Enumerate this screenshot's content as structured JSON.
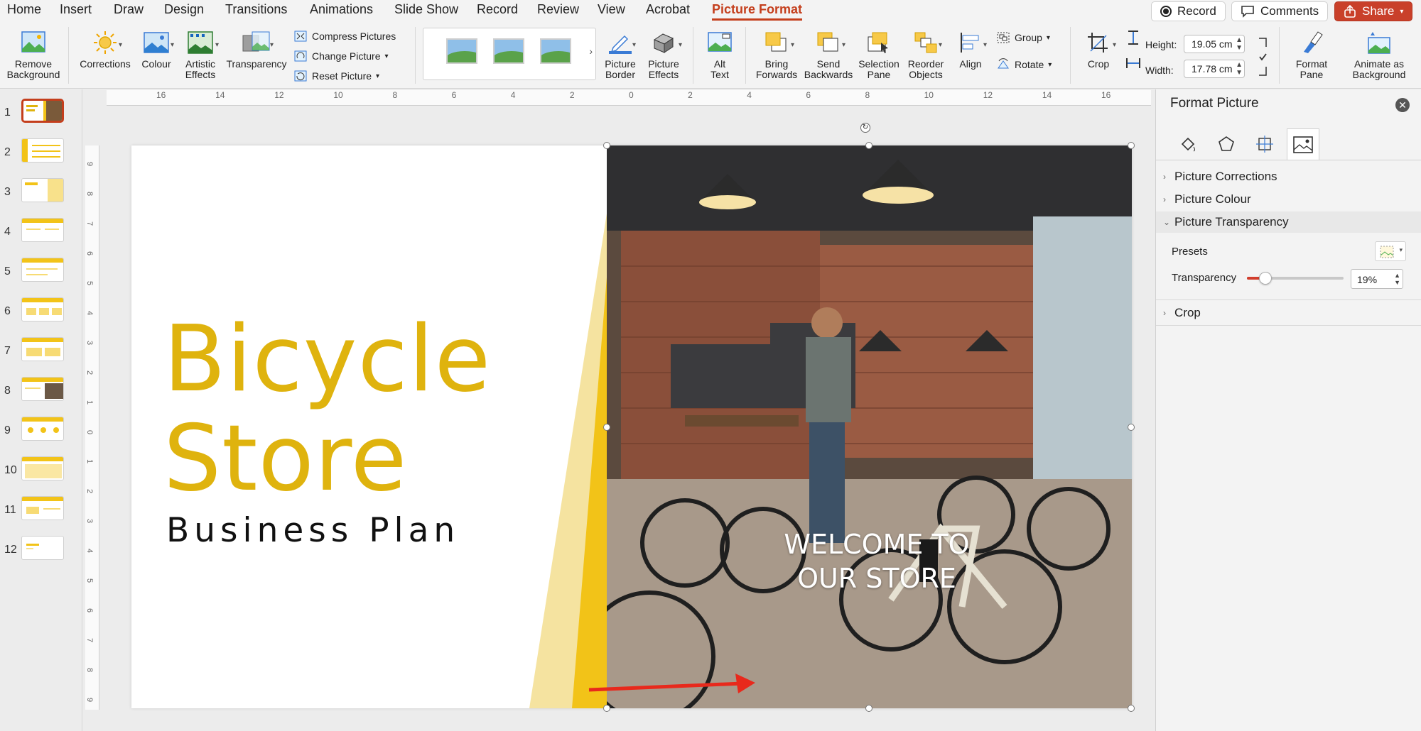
{
  "tabs": [
    {
      "label": "Home"
    },
    {
      "label": "Insert"
    },
    {
      "label": "Draw"
    },
    {
      "label": "Design"
    },
    {
      "label": "Transitions"
    },
    {
      "label": "Animations"
    },
    {
      "label": "Slide Show"
    },
    {
      "label": "Record"
    },
    {
      "label": "Review"
    },
    {
      "label": "View"
    },
    {
      "label": "Acrobat"
    },
    {
      "label": "Picture Format",
      "active": true
    }
  ],
  "top_buttons": {
    "record": "Record",
    "comments": "Comments",
    "share": "Share"
  },
  "ribbon": {
    "remove_background": "Remove\nBackground",
    "corrections": "Corrections",
    "colour": "Colour",
    "artistic_effects": "Artistic\nEffects",
    "transparency": "Transparency",
    "compress_pictures": "Compress Pictures",
    "change_picture": "Change Picture",
    "reset_picture": "Reset Picture",
    "picture_border": "Picture\nBorder",
    "picture_effects": "Picture\nEffects",
    "alt_text": "Alt\nText",
    "bring_forwards": "Bring\nForwards",
    "send_backwards": "Send\nBackwards",
    "selection_pane": "Selection\nPane",
    "reorder_objects": "Reorder\nObjects",
    "align": "Align",
    "group": "Group",
    "rotate": "Rotate",
    "crop": "Crop",
    "height_label": "Height:",
    "height_value": "19.05 cm",
    "width_label": "Width:",
    "width_value": "17.78 cm",
    "format_pane": "Format\nPane",
    "animate_as_background": "Animate as\nBackground"
  },
  "ruler": {
    "h_ticks": [
      "16",
      "14",
      "12",
      "10",
      "8",
      "6",
      "4",
      "2",
      "0",
      "2",
      "4",
      "6",
      "8",
      "10",
      "12",
      "14",
      "16"
    ],
    "v_ticks": [
      "9",
      "8",
      "7",
      "6",
      "5",
      "4",
      "3",
      "2",
      "1",
      "0",
      "1",
      "2",
      "3",
      "4",
      "5",
      "6",
      "7",
      "8",
      "9"
    ]
  },
  "slides": [
    {
      "num": "1",
      "selected": true
    },
    {
      "num": "2"
    },
    {
      "num": "3"
    },
    {
      "num": "4"
    },
    {
      "num": "5"
    },
    {
      "num": "6"
    },
    {
      "num": "7"
    },
    {
      "num": "8"
    },
    {
      "num": "9"
    },
    {
      "num": "10"
    },
    {
      "num": "11"
    },
    {
      "num": "12"
    }
  ],
  "slide": {
    "title_line1": "Bicycle",
    "title_line2": "Store",
    "subtitle": "Business Plan",
    "overlay_line1": "WELCOME TO",
    "overlay_line2": "OUR STORE",
    "title_color": "#dfb30e",
    "accent_color": "#f2c318"
  },
  "pane": {
    "title": "Format Picture",
    "tab_icons": [
      "fill-line-icon",
      "effects-icon",
      "size-properties-icon",
      "picture-icon"
    ],
    "sections": {
      "corrections": "Picture Corrections",
      "colour": "Picture Colour",
      "transparency": "Picture Transparency",
      "crop": "Crop"
    },
    "presets_label": "Presets",
    "transparency_label": "Transparency",
    "transparency_value": "19%",
    "transparency_fraction": 0.19
  }
}
